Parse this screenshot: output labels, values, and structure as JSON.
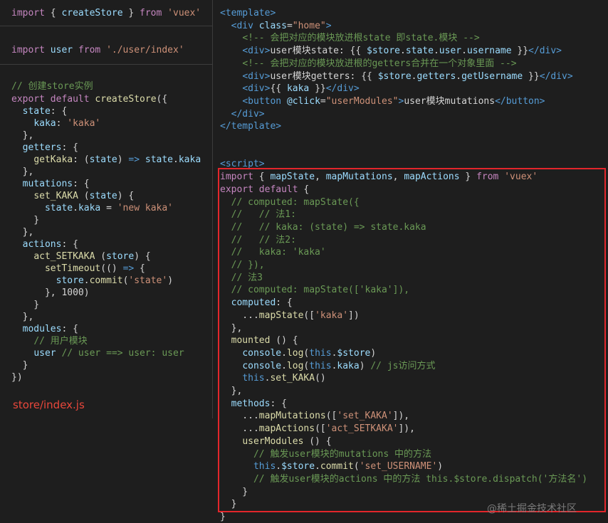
{
  "left_code": [
    [
      [
        "kw2",
        "import"
      ],
      [
        "txt",
        " { "
      ],
      [
        "var",
        "createStore"
      ],
      [
        "txt",
        " } "
      ],
      [
        "kw2",
        "from"
      ],
      [
        "txt",
        " "
      ],
      [
        "str",
        "'vuex'"
      ]
    ],
    [],
    [
      [
        "kw2",
        "import"
      ],
      [
        "txt",
        " "
      ],
      [
        "var",
        "user"
      ],
      [
        "txt",
        " "
      ],
      [
        "kw2",
        "from"
      ],
      [
        "txt",
        " "
      ],
      [
        "str",
        "'./user/index'"
      ]
    ],
    [],
    [
      [
        "cm",
        "// 创建store实例"
      ]
    ],
    [
      [
        "kw2",
        "export"
      ],
      [
        "txt",
        " "
      ],
      [
        "kw2",
        "default"
      ],
      [
        "txt",
        " "
      ],
      [
        "fn",
        "createStore"
      ],
      [
        "txt",
        "({"
      ]
    ],
    [
      [
        "txt",
        "  "
      ],
      [
        "var",
        "state"
      ],
      [
        "txt",
        ": {"
      ]
    ],
    [
      [
        "txt",
        "    "
      ],
      [
        "var",
        "kaka"
      ],
      [
        "txt",
        ": "
      ],
      [
        "str",
        "'kaka'"
      ]
    ],
    [
      [
        "txt",
        "  },"
      ]
    ],
    [
      [
        "txt",
        "  "
      ],
      [
        "var",
        "getters"
      ],
      [
        "txt",
        ": {"
      ]
    ],
    [
      [
        "txt",
        "    "
      ],
      [
        "fn",
        "getKaka"
      ],
      [
        "txt",
        ": ("
      ],
      [
        "var",
        "state"
      ],
      [
        "txt",
        ") "
      ],
      [
        "kw",
        "=>"
      ],
      [
        "txt",
        " "
      ],
      [
        "var",
        "state"
      ],
      [
        "txt",
        "."
      ],
      [
        "var",
        "kaka"
      ]
    ],
    [
      [
        "txt",
        "  },"
      ]
    ],
    [
      [
        "txt",
        "  "
      ],
      [
        "var",
        "mutations"
      ],
      [
        "txt",
        ": {"
      ]
    ],
    [
      [
        "txt",
        "    "
      ],
      [
        "fn",
        "set_KAKA"
      ],
      [
        "txt",
        " ("
      ],
      [
        "var",
        "state"
      ],
      [
        "txt",
        ") {"
      ]
    ],
    [
      [
        "txt",
        "      "
      ],
      [
        "var",
        "state"
      ],
      [
        "txt",
        "."
      ],
      [
        "var",
        "kaka"
      ],
      [
        "txt",
        " = "
      ],
      [
        "str",
        "'new kaka'"
      ]
    ],
    [
      [
        "txt",
        "    }"
      ]
    ],
    [
      [
        "txt",
        "  },"
      ]
    ],
    [
      [
        "txt",
        "  "
      ],
      [
        "var",
        "actions"
      ],
      [
        "txt",
        ": {"
      ]
    ],
    [
      [
        "txt",
        "    "
      ],
      [
        "fn",
        "act_SETKAKA"
      ],
      [
        "txt",
        " ("
      ],
      [
        "var",
        "store"
      ],
      [
        "txt",
        ") {"
      ]
    ],
    [
      [
        "txt",
        "      "
      ],
      [
        "fn",
        "setTimeout"
      ],
      [
        "txt",
        "(() "
      ],
      [
        "kw",
        "=>"
      ],
      [
        "txt",
        " {"
      ]
    ],
    [
      [
        "txt",
        "        "
      ],
      [
        "var",
        "store"
      ],
      [
        "txt",
        "."
      ],
      [
        "fn",
        "commit"
      ],
      [
        "txt",
        "("
      ],
      [
        "str",
        "'state'"
      ],
      [
        "txt",
        ")"
      ]
    ],
    [
      [
        "txt",
        "      }, 1000)"
      ]
    ],
    [
      [
        "txt",
        "    }"
      ]
    ],
    [
      [
        "txt",
        "  },"
      ]
    ],
    [
      [
        "txt",
        "  "
      ],
      [
        "var",
        "modules"
      ],
      [
        "txt",
        ": {"
      ]
    ],
    [
      [
        "txt",
        "    "
      ],
      [
        "cm",
        "// 用户模块"
      ]
    ],
    [
      [
        "txt",
        "    "
      ],
      [
        "var",
        "user"
      ],
      [
        "txt",
        " "
      ],
      [
        "cm",
        "// user ==> user: user"
      ]
    ],
    [
      [
        "txt",
        "  }"
      ]
    ],
    [
      [
        "txt",
        "})"
      ]
    ]
  ],
  "left_file_label": "store/index.js",
  "right_code": [
    [
      [
        "tag",
        "<template>"
      ]
    ],
    [
      [
        "txt",
        "  "
      ],
      [
        "tag",
        "<div"
      ],
      [
        "txt",
        " "
      ],
      [
        "attr",
        "class"
      ],
      [
        "txt",
        "="
      ],
      [
        "str",
        "\"home\""
      ],
      [
        "tag",
        ">"
      ]
    ],
    [
      [
        "txt",
        "    "
      ],
      [
        "cm",
        "<!-- 会把对应的模块放进根state 即state.模块 -->"
      ]
    ],
    [
      [
        "txt",
        "    "
      ],
      [
        "tag",
        "<div>"
      ],
      [
        "txt",
        "user模块state: {{ "
      ],
      [
        "var",
        "$store"
      ],
      [
        "txt",
        "."
      ],
      [
        "var",
        "state"
      ],
      [
        "txt",
        "."
      ],
      [
        "var",
        "user"
      ],
      [
        "txt",
        "."
      ],
      [
        "var",
        "username"
      ],
      [
        "txt",
        " }}"
      ],
      [
        "tag",
        "</div>"
      ]
    ],
    [
      [
        "txt",
        "    "
      ],
      [
        "cm",
        "<!-- 会把对应的模块放进根的getters合并在一个对象里面 -->"
      ]
    ],
    [
      [
        "txt",
        "    "
      ],
      [
        "tag",
        "<div>"
      ],
      [
        "txt",
        "user模块getters: {{ "
      ],
      [
        "var",
        "$store"
      ],
      [
        "txt",
        "."
      ],
      [
        "var",
        "getters"
      ],
      [
        "txt",
        "."
      ],
      [
        "var",
        "getUsername"
      ],
      [
        "txt",
        " }}"
      ],
      [
        "tag",
        "</div>"
      ]
    ],
    [
      [
        "txt",
        "    "
      ],
      [
        "tag",
        "<div>"
      ],
      [
        "txt",
        "{{ "
      ],
      [
        "var",
        "kaka"
      ],
      [
        "txt",
        " }}"
      ],
      [
        "tag",
        "</div>"
      ]
    ],
    [
      [
        "txt",
        "    "
      ],
      [
        "tag",
        "<button"
      ],
      [
        "txt",
        " "
      ],
      [
        "attr",
        "@click"
      ],
      [
        "txt",
        "="
      ],
      [
        "str",
        "\"userModules\""
      ],
      [
        "tag",
        ">"
      ],
      [
        "txt",
        "user模块mutations"
      ],
      [
        "tag",
        "</button>"
      ]
    ],
    [
      [
        "txt",
        "  "
      ],
      [
        "tag",
        "</div>"
      ]
    ],
    [
      [
        "tag",
        "</template>"
      ]
    ],
    [],
    [],
    [
      [
        "tag",
        "<script>"
      ]
    ],
    [
      [
        "kw2",
        "import"
      ],
      [
        "txt",
        " { "
      ],
      [
        "var",
        "mapState"
      ],
      [
        "txt",
        ", "
      ],
      [
        "var",
        "mapMutations"
      ],
      [
        "txt",
        ", "
      ],
      [
        "var",
        "mapActions"
      ],
      [
        "txt",
        " } "
      ],
      [
        "kw2",
        "from"
      ],
      [
        "txt",
        " "
      ],
      [
        "str",
        "'vuex'"
      ]
    ],
    [
      [
        "kw2",
        "export"
      ],
      [
        "txt",
        " "
      ],
      [
        "kw2",
        "default"
      ],
      [
        "txt",
        " {"
      ]
    ],
    [
      [
        "txt",
        "  "
      ],
      [
        "cm",
        "// computed: mapState({"
      ]
    ],
    [
      [
        "txt",
        "  "
      ],
      [
        "cm",
        "//   // 法1:"
      ]
    ],
    [
      [
        "txt",
        "  "
      ],
      [
        "cm",
        "//   // kaka: (state) => state.kaka"
      ]
    ],
    [
      [
        "txt",
        "  "
      ],
      [
        "cm",
        "//   // 法2:"
      ]
    ],
    [
      [
        "txt",
        "  "
      ],
      [
        "cm",
        "//   kaka: 'kaka'"
      ]
    ],
    [
      [
        "txt",
        "  "
      ],
      [
        "cm",
        "// }),"
      ]
    ],
    [
      [
        "txt",
        "  "
      ],
      [
        "cm",
        "// 法3"
      ]
    ],
    [
      [
        "txt",
        "  "
      ],
      [
        "cm",
        "// computed: mapState(['kaka']),"
      ]
    ],
    [
      [
        "txt",
        "  "
      ],
      [
        "var",
        "computed"
      ],
      [
        "txt",
        ": {"
      ]
    ],
    [
      [
        "txt",
        "    ..."
      ],
      [
        "fn",
        "mapState"
      ],
      [
        "txt",
        "(["
      ],
      [
        "str",
        "'kaka'"
      ],
      [
        "txt",
        "])"
      ]
    ],
    [
      [
        "txt",
        "  },"
      ]
    ],
    [
      [
        "txt",
        "  "
      ],
      [
        "fn",
        "mounted"
      ],
      [
        "txt",
        " () {"
      ]
    ],
    [
      [
        "txt",
        "    "
      ],
      [
        "var",
        "console"
      ],
      [
        "txt",
        "."
      ],
      [
        "fn",
        "log"
      ],
      [
        "txt",
        "("
      ],
      [
        "kw",
        "this"
      ],
      [
        "txt",
        "."
      ],
      [
        "var",
        "$store"
      ],
      [
        "txt",
        ")"
      ]
    ],
    [
      [
        "txt",
        "    "
      ],
      [
        "var",
        "console"
      ],
      [
        "txt",
        "."
      ],
      [
        "fn",
        "log"
      ],
      [
        "txt",
        "("
      ],
      [
        "kw",
        "this"
      ],
      [
        "txt",
        "."
      ],
      [
        "var",
        "kaka"
      ],
      [
        "txt",
        ") "
      ],
      [
        "cm",
        "// js访问方式"
      ]
    ],
    [
      [
        "txt",
        "    "
      ],
      [
        "kw",
        "this"
      ],
      [
        "txt",
        "."
      ],
      [
        "fn",
        "set_KAKA"
      ],
      [
        "txt",
        "()"
      ]
    ],
    [
      [
        "txt",
        "  },"
      ]
    ],
    [
      [
        "txt",
        "  "
      ],
      [
        "var",
        "methods"
      ],
      [
        "txt",
        ": {"
      ]
    ],
    [
      [
        "txt",
        "    ..."
      ],
      [
        "fn",
        "mapMutations"
      ],
      [
        "txt",
        "(["
      ],
      [
        "str",
        "'set_KAKA'"
      ],
      [
        "txt",
        "]),"
      ]
    ],
    [
      [
        "txt",
        "    ..."
      ],
      [
        "fn",
        "mapActions"
      ],
      [
        "txt",
        "(["
      ],
      [
        "str",
        "'act_SETKAKA'"
      ],
      [
        "txt",
        "]),"
      ]
    ],
    [
      [
        "txt",
        "    "
      ],
      [
        "fn",
        "userModules"
      ],
      [
        "txt",
        " () {"
      ]
    ],
    [
      [
        "txt",
        "      "
      ],
      [
        "cm",
        "// 触发user模块的mutations 中的方法"
      ]
    ],
    [
      [
        "txt",
        "      "
      ],
      [
        "kw",
        "this"
      ],
      [
        "txt",
        "."
      ],
      [
        "var",
        "$store"
      ],
      [
        "txt",
        "."
      ],
      [
        "fn",
        "commit"
      ],
      [
        "txt",
        "("
      ],
      [
        "str",
        "'set_USERNAME'"
      ],
      [
        "txt",
        ")"
      ]
    ],
    [
      [
        "txt",
        "      "
      ],
      [
        "cm",
        "// 触发user模块的actions 中的方法 this.$store.dispatch('方法名')"
      ]
    ],
    [
      [
        "txt",
        "    }"
      ]
    ],
    [
      [
        "txt",
        "  }"
      ]
    ],
    [
      [
        "txt",
        "}"
      ]
    ]
  ],
  "watermark": "@稀土掘金技术社区",
  "colors": {
    "highlight": "#e3262b",
    "file_label": "#e8473b"
  }
}
